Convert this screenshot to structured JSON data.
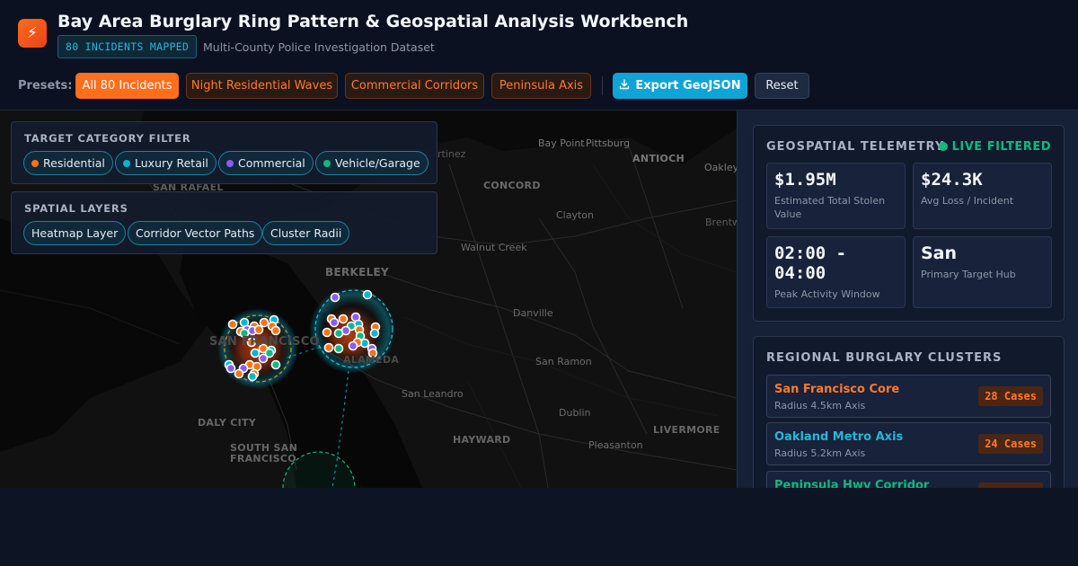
{
  "header": {
    "logo_glyph": "⚡",
    "title": "Bay Area Burglary Ring Pattern & Geospatial Analysis Workbench",
    "mapped_badge": "80 INCIDENTS MAPPED",
    "subtitle": "Multi-County Police Investigation Dataset"
  },
  "toolbar": {
    "presets_label": "Presets:",
    "presets": [
      {
        "label": "All 80 Incidents",
        "active": true
      },
      {
        "label": "Night Residential Waves",
        "active": false
      },
      {
        "label": "Commercial Corridors",
        "active": false
      },
      {
        "label": "Peninsula Axis",
        "active": false
      }
    ],
    "export_label": "Export GeoJSON",
    "reset_label": "Reset"
  },
  "map": {
    "category_filter": {
      "title": "TARGET CATEGORY FILTER",
      "chips": [
        {
          "label": "Residential",
          "color": "#f97316"
        },
        {
          "label": "Luxury Retail",
          "color": "#06b6d4"
        },
        {
          "label": "Commercial",
          "color": "#8b5cf6"
        },
        {
          "label": "Vehicle/Garage",
          "color": "#10b981"
        }
      ]
    },
    "spatial_layers": {
      "title": "SPATIAL LAYERS",
      "chips": [
        {
          "label": "Heatmap Layer"
        },
        {
          "label": "Corridor Vector Paths"
        },
        {
          "label": "Cluster Radii"
        }
      ]
    },
    "places": {
      "bay_point": "Bay Point",
      "pittsburg": "Pittsburg",
      "martinez": "rtinez",
      "antioch": "ANTIOCH",
      "oakley": "Oakley",
      "san_rafael": "SAN RAFAEL",
      "concord": "CONCORD",
      "clayton": "Clayton",
      "brentwood": "Brentw",
      "walnut_creek": "Walnut Creek",
      "berkeley": "BERKELEY",
      "danville": "Danville",
      "san_francisco": "SAN FRANCISCO",
      "alameda": "ALAMEDA",
      "san_ramon": "San Ramon",
      "san_leandro": "San Leandro",
      "dublin": "Dublin",
      "livermore": "LIVERMORE",
      "daly_city": "DALY CITY",
      "hayward": "HAYWARD",
      "pleasanton": "Pleasanton",
      "south_sf_1": "SOUTH SAN",
      "south_sf_2": "FRANCISCO"
    }
  },
  "telemetry": {
    "title": "GEOSPATIAL TELEMETRY",
    "live_label": "LIVE FILTERED",
    "stats": [
      {
        "value": "$1.95M",
        "label": "Estimated Total Stolen Value"
      },
      {
        "value": "$24.3K",
        "label": "Avg Loss / Incident"
      },
      {
        "value": "02:00 - 04:00",
        "label": "Peak Activity Window"
      },
      {
        "value": "San",
        "label": "Primary Target Hub"
      }
    ]
  },
  "clusters": {
    "title": "REGIONAL BURGLARY CLUSTERS",
    "items": [
      {
        "name": "San Francisco Core",
        "sub": "Radius 4.5km Axis",
        "cases": "28 Cases",
        "color": "#ff7a2c"
      },
      {
        "name": "Oakland Metro Axis",
        "sub": "Radius 5.2km Axis",
        "cases": "24 Cases",
        "color": "#22b8dc"
      },
      {
        "name": "Peninsula Hwy Corridor",
        "sub": "",
        "cases": "",
        "color": "#10b981"
      }
    ]
  }
}
